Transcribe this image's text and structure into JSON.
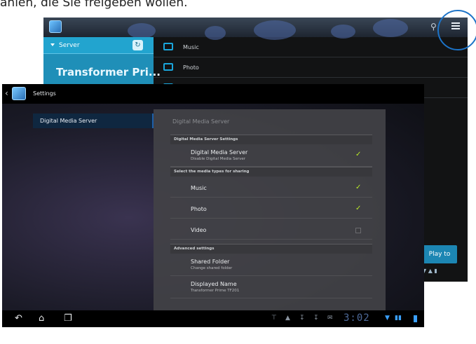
{
  "caption": "ahlen, die Sie freigeben wollen.",
  "background_app": {
    "server_label": "Server",
    "device_name": "Transformer Pri...",
    "folders": [
      "Music",
      "Photo"
    ],
    "play_to_label": "Play to",
    "icons": [
      "search-icon",
      "menu-icon",
      "refresh-icon",
      "folder-icon"
    ]
  },
  "settings": {
    "title": "Settings",
    "nav_item": "Digital Media Server",
    "panel_title": "Digital Media Server",
    "sections": [
      {
        "header": "Digital Media Server Settings",
        "items": [
          {
            "title": "Digital Media Server",
            "subtitle": "Disable Digital Media Server",
            "checked": true
          }
        ]
      },
      {
        "header": "Select the media types for sharing",
        "items": [
          {
            "title": "Music",
            "checked": true
          },
          {
            "title": "Photo",
            "checked": true
          },
          {
            "title": "Video",
            "checked": false
          }
        ]
      },
      {
        "header": "Advanced settings",
        "items": [
          {
            "title": "Shared Folder",
            "subtitle": "Change shared folder"
          },
          {
            "title": "Displayed Name",
            "subtitle": "Transformer Prime TF201"
          }
        ]
      }
    ]
  },
  "system_bar": {
    "clock": "3:02",
    "icons": [
      "back-icon",
      "home-icon",
      "recent-apps-icon"
    ]
  },
  "colors": {
    "accent_blue": "#1f8fb8",
    "check_green": "#b9ea27",
    "highlight_circle": "#1c73c7"
  }
}
